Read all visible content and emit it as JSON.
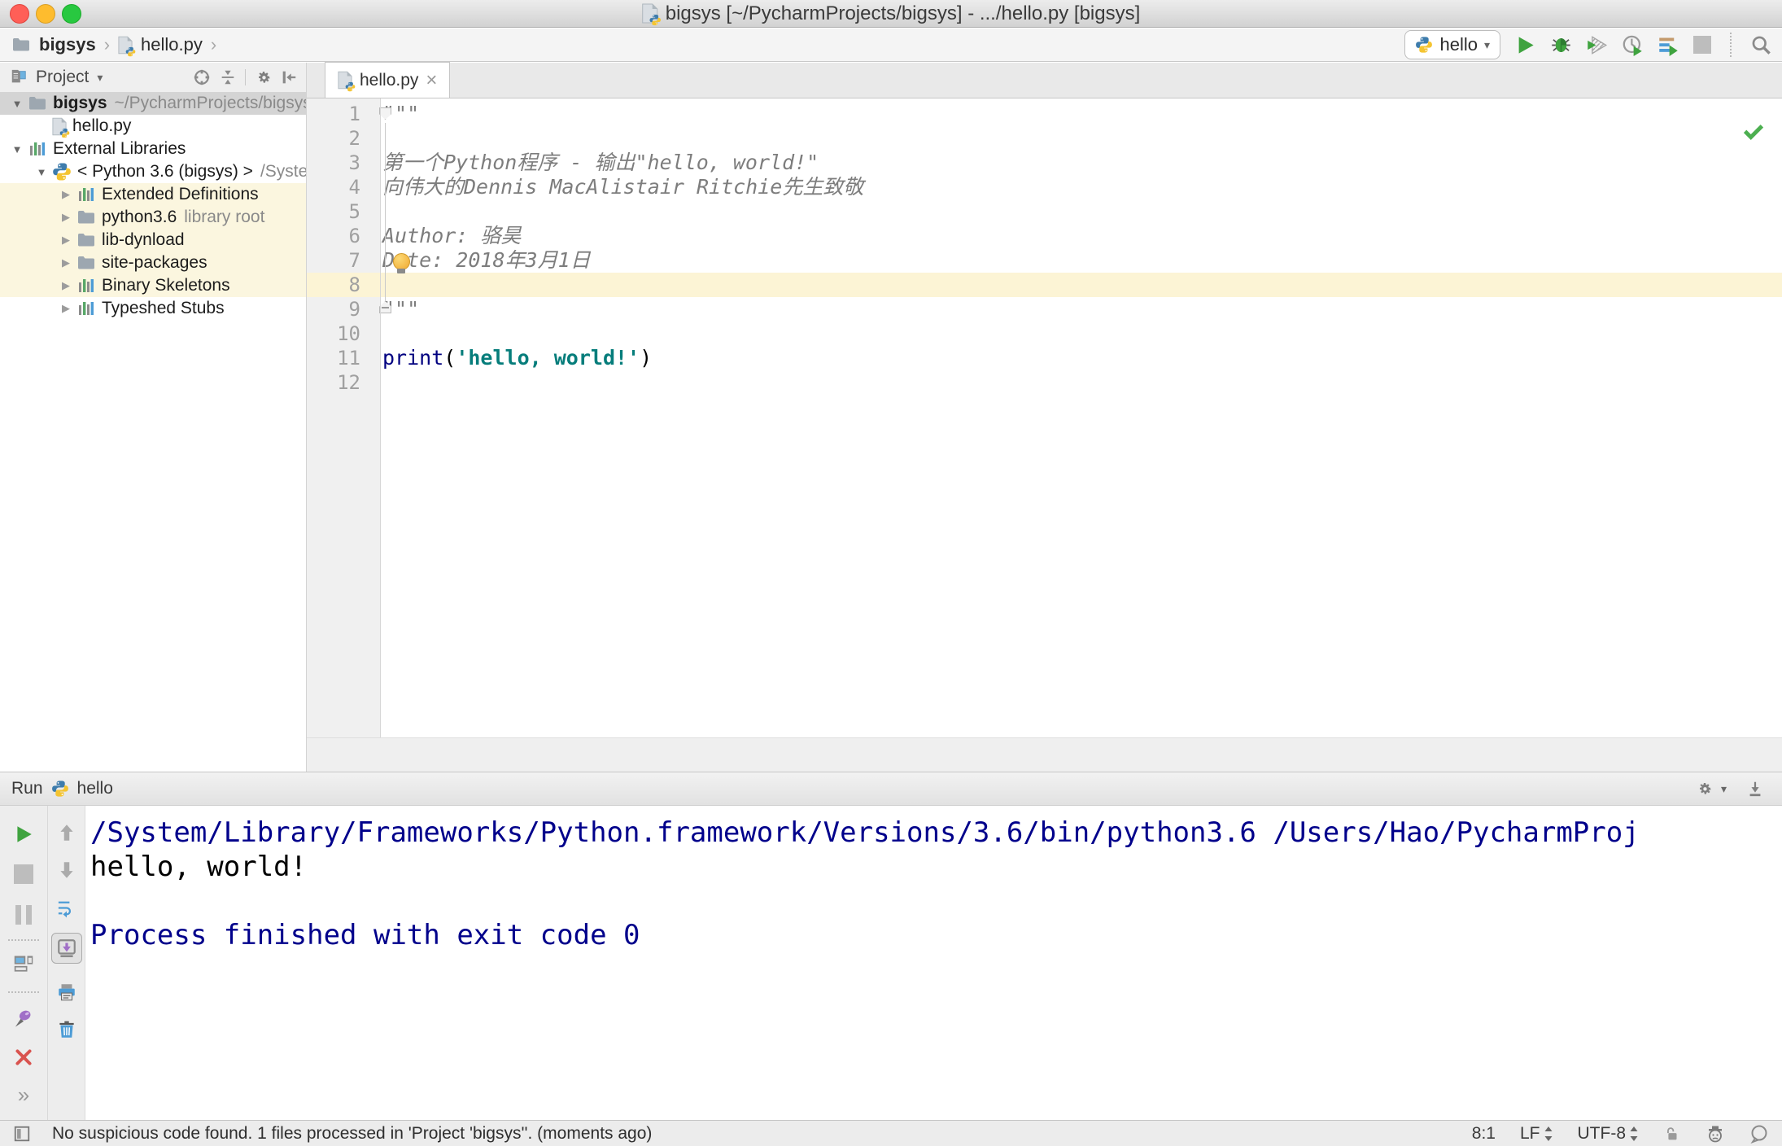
{
  "ui": {
    "dropdown": "▾"
  },
  "window": {
    "title": "bigsys [~/PycharmProjects/bigsys] - .../hello.py [bigsys]"
  },
  "navbar": {
    "crumb1": "bigsys",
    "crumb2": "hello.py",
    "sep": "›",
    "run_config": {
      "label": "hello"
    }
  },
  "project": {
    "header": {
      "title": "Project"
    },
    "tree": [
      {
        "arrow": "▼",
        "label": "bigsys",
        "extra": "~/PycharmProjects/bigsys"
      },
      {
        "arrow": "",
        "label": "hello.py",
        "extra": ""
      },
      {
        "arrow": "▼",
        "label": "External Libraries",
        "extra": ""
      },
      {
        "arrow": "▼",
        "label": "< Python 3.6 (bigsys) >",
        "extra": "/System"
      },
      {
        "arrow": "▶",
        "label": "Extended Definitions",
        "extra": ""
      },
      {
        "arrow": "▶",
        "label": "python3.6",
        "extra": "library root"
      },
      {
        "arrow": "▶",
        "label": "lib-dynload",
        "extra": ""
      },
      {
        "arrow": "▶",
        "label": "site-packages",
        "extra": ""
      },
      {
        "arrow": "▶",
        "label": "Binary Skeletons",
        "extra": ""
      },
      {
        "arrow": "▶",
        "label": "Typeshed Stubs",
        "extra": ""
      }
    ]
  },
  "editor": {
    "tab": {
      "label": "hello.py",
      "close": "×"
    },
    "code": [
      {
        "n": "1",
        "doc": "\"\"\""
      },
      {
        "n": "2",
        "doc": ""
      },
      {
        "n": "3",
        "doc": "第一个Python程序 - 输出\"hello, world!\""
      },
      {
        "n": "4",
        "doc": "向伟大的Dennis MacAlistair Ritchie先生致敬"
      },
      {
        "n": "5",
        "doc": ""
      },
      {
        "n": "6",
        "doc": "Author: 骆昊"
      },
      {
        "n": "7",
        "doc": "Date: 2018年3月1日"
      },
      {
        "n": "8",
        "doc": ""
      },
      {
        "n": "9",
        "doc": "\"\"\""
      },
      {
        "n": "10",
        "doc": ""
      },
      {
        "n": "11",
        "kw": "print",
        "p1": "(",
        "str": "'hello, world!'",
        "p2": ")"
      },
      {
        "n": "12",
        "doc": ""
      }
    ]
  },
  "run": {
    "title": "Run",
    "config": "hello",
    "more": "»",
    "console": [
      {
        "text": "/System/Library/Frameworks/Python.framework/Versions/3.6/bin/python3.6 /Users/Hao/PycharmProj"
      },
      {
        "text": "hello, world!"
      },
      {
        "text": " "
      },
      {
        "text": "Process finished with exit code 0"
      }
    ]
  },
  "status": {
    "message": "No suspicious code found. 1 files processed in 'Project 'bigsys''. (moments ago)",
    "caret": "8:1",
    "line_sep": "LF",
    "encoding": "UTF-8"
  },
  "colors": {
    "accent_green": "#3FA33F",
    "keyword_blue": "#000080",
    "string_teal": "#067D7B",
    "console_info_blue": "#00008B",
    "current_line": "#FCF4D5",
    "library_highlight": "#FBF6DF",
    "inactive_selection": "#D4D4D4"
  }
}
